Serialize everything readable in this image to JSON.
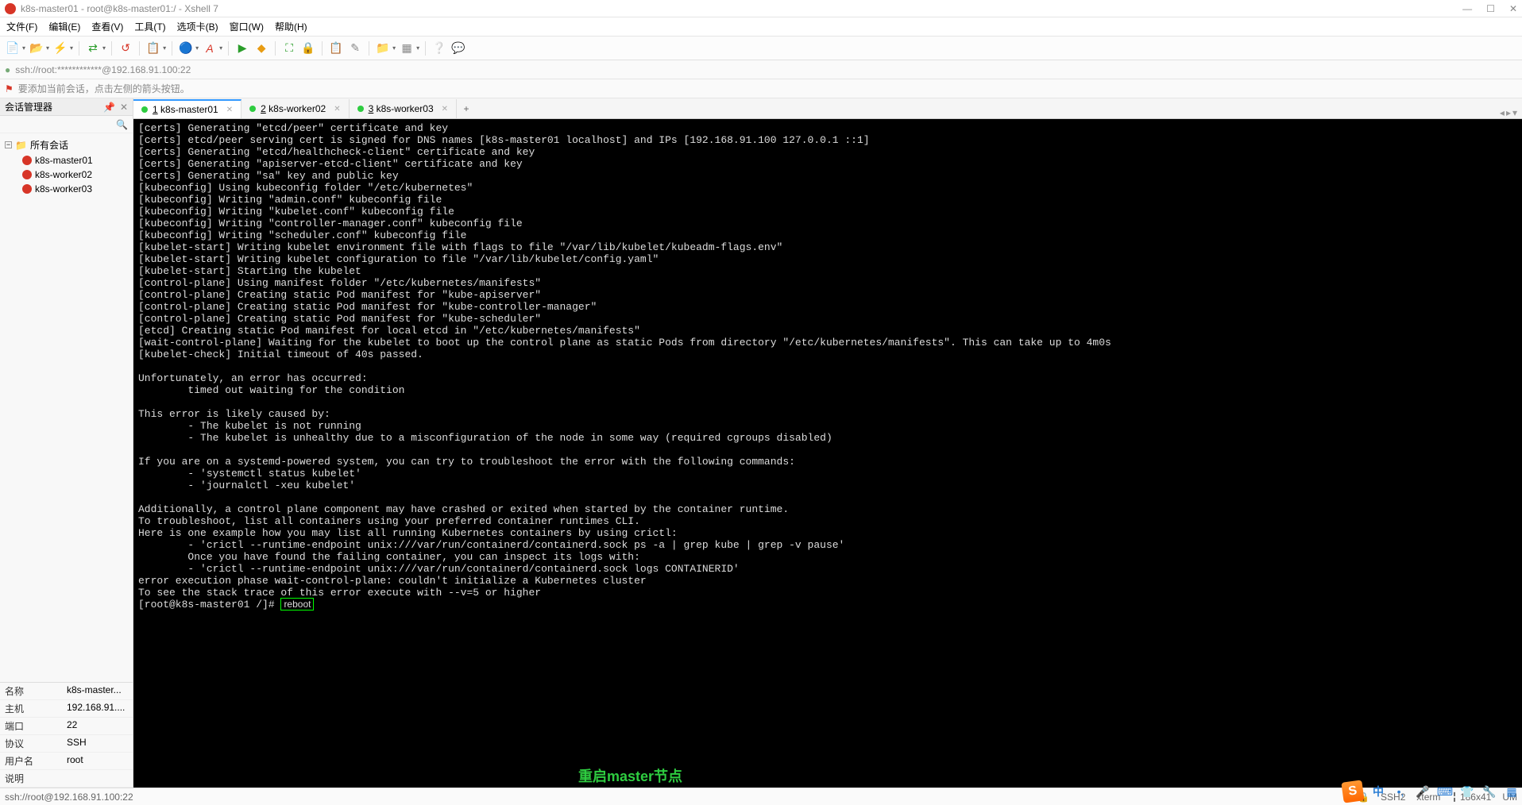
{
  "window": {
    "title": "k8s-master01 - root@k8s-master01:/ - Xshell 7"
  },
  "menubar": [
    "文件(F)",
    "编辑(E)",
    "查看(V)",
    "工具(T)",
    "选项卡(B)",
    "窗口(W)",
    "帮助(H)"
  ],
  "addressbar": {
    "text": "ssh://root:************@192.168.91.100:22"
  },
  "hintbar": {
    "text": "要添加当前会话，点击左侧的箭头按钮。"
  },
  "sidebar": {
    "title": "会话管理器",
    "root": "所有会话",
    "items": [
      {
        "label": "k8s-master01"
      },
      {
        "label": "k8s-worker02"
      },
      {
        "label": "k8s-worker03"
      }
    ],
    "props_labels": {
      "name": "名称",
      "host": "主机",
      "port": "端口",
      "protocol": "协议",
      "user": "用户名",
      "desc": "说明"
    },
    "props": {
      "name": "k8s-master...",
      "host": "192.168.91....",
      "port": "22",
      "protocol": "SSH",
      "user": "root",
      "desc": ""
    }
  },
  "tabs": [
    {
      "num": "1",
      "label": "k8s-master01",
      "active": true
    },
    {
      "num": "2",
      "label": "k8s-worker02",
      "active": false
    },
    {
      "num": "3",
      "label": "k8s-worker03",
      "active": false
    }
  ],
  "terminal": {
    "lines": [
      "[certs] Generating \"etcd/peer\" certificate and key",
      "[certs] etcd/peer serving cert is signed for DNS names [k8s-master01 localhost] and IPs [192.168.91.100 127.0.0.1 ::1]",
      "[certs] Generating \"etcd/healthcheck-client\" certificate and key",
      "[certs] Generating \"apiserver-etcd-client\" certificate and key",
      "[certs] Generating \"sa\" key and public key",
      "[kubeconfig] Using kubeconfig folder \"/etc/kubernetes\"",
      "[kubeconfig] Writing \"admin.conf\" kubeconfig file",
      "[kubeconfig] Writing \"kubelet.conf\" kubeconfig file",
      "[kubeconfig] Writing \"controller-manager.conf\" kubeconfig file",
      "[kubeconfig] Writing \"scheduler.conf\" kubeconfig file",
      "[kubelet-start] Writing kubelet environment file with flags to file \"/var/lib/kubelet/kubeadm-flags.env\"",
      "[kubelet-start] Writing kubelet configuration to file \"/var/lib/kubelet/config.yaml\"",
      "[kubelet-start] Starting the kubelet",
      "[control-plane] Using manifest folder \"/etc/kubernetes/manifests\"",
      "[control-plane] Creating static Pod manifest for \"kube-apiserver\"",
      "[control-plane] Creating static Pod manifest for \"kube-controller-manager\"",
      "[control-plane] Creating static Pod manifest for \"kube-scheduler\"",
      "[etcd] Creating static Pod manifest for local etcd in \"/etc/kubernetes/manifests\"",
      "[wait-control-plane] Waiting for the kubelet to boot up the control plane as static Pods from directory \"/etc/kubernetes/manifests\". This can take up to 4m0s",
      "[kubelet-check] Initial timeout of 40s passed.",
      "",
      "Unfortunately, an error has occurred:",
      "        timed out waiting for the condition",
      "",
      "This error is likely caused by:",
      "        - The kubelet is not running",
      "        - The kubelet is unhealthy due to a misconfiguration of the node in some way (required cgroups disabled)",
      "",
      "If you are on a systemd-powered system, you can try to troubleshoot the error with the following commands:",
      "        - 'systemctl status kubelet'",
      "        - 'journalctl -xeu kubelet'",
      "",
      "Additionally, a control plane component may have crashed or exited when started by the container runtime.",
      "To troubleshoot, list all containers using your preferred container runtimes CLI.",
      "Here is one example how you may list all running Kubernetes containers by using crictl:",
      "        - 'crictl --runtime-endpoint unix:///var/run/containerd/containerd.sock ps -a | grep kube | grep -v pause'",
      "        Once you have found the failing container, you can inspect its logs with:",
      "        - 'crictl --runtime-endpoint unix:///var/run/containerd/containerd.sock logs CONTAINERID'",
      "error execution phase wait-control-plane: couldn't initialize a Kubernetes cluster",
      "To see the stack trace of this error execute with --v=5 or higher"
    ],
    "prompt": "[root@k8s-master01 /]# ",
    "command": "reboot",
    "annotation": "重启master节点"
  },
  "statusbar": {
    "left": "ssh://root@192.168.91.100:22",
    "ssh": "SSH2",
    "term": "xterm",
    "size": "186x41",
    "extra": "UM"
  },
  "ime": {
    "badge": "S",
    "lang": "中"
  }
}
